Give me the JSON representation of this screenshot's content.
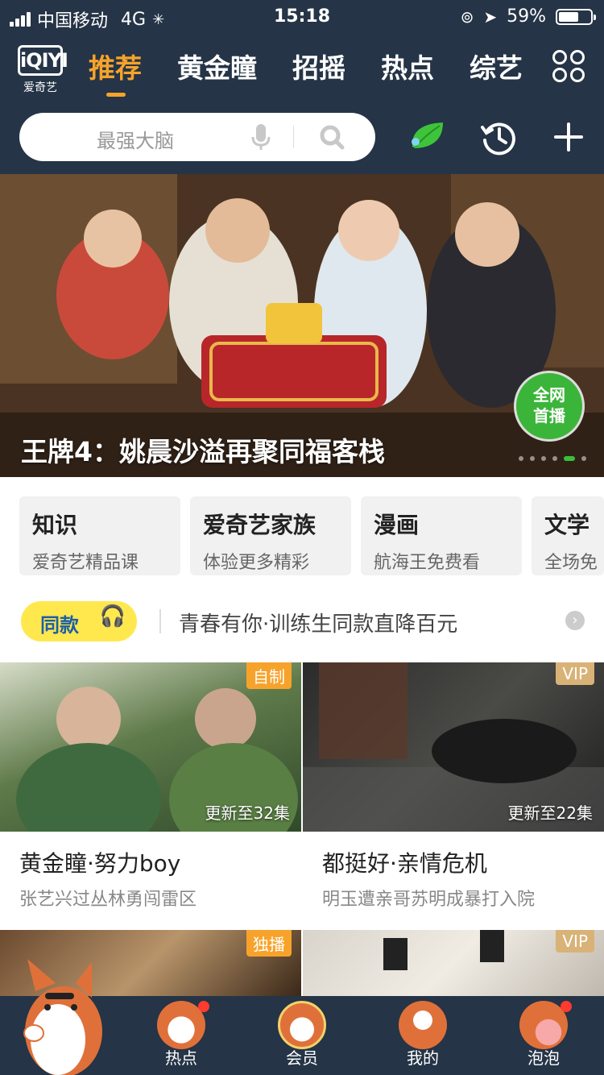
{
  "status_bar": {
    "carrier": "中国移动",
    "network": "4G",
    "time": "15:18",
    "battery": "59%",
    "battery_level": 0.59
  },
  "header": {
    "logo_mark": "iQIYI",
    "logo_cn": "爱奇艺",
    "tabs": [
      {
        "label": "推荐",
        "active": true
      },
      {
        "label": "黄金瞳",
        "active": false
      },
      {
        "label": "招摇",
        "active": false
      },
      {
        "label": "热点",
        "active": false
      },
      {
        "label": "综艺",
        "active": false
      }
    ],
    "icons": [
      "more-grid-icon",
      "leaf-icon",
      "history-clock-icon",
      "plus-icon"
    ],
    "search_placeholder": "最强大脑"
  },
  "banner": {
    "title": "王牌4：姚晨沙溢再聚同福客栈",
    "live_badge": [
      "全网",
      "首播"
    ],
    "slide_count": 6,
    "active_slide": 5
  },
  "categories": [
    {
      "title": "知识",
      "subtitle": "爱奇艺精品课"
    },
    {
      "title": "爱奇艺家族",
      "subtitle": "体验更多精彩"
    },
    {
      "title": "漫画",
      "subtitle": "航海王免费看"
    },
    {
      "title": "文学",
      "subtitle": "全场免"
    }
  ],
  "promo": {
    "pill_label": "同款",
    "text": "青春有你·训练生同款直降百元"
  },
  "cards": [
    {
      "tag": "自制",
      "episode": "更新至32集",
      "title": "黄金瞳·努力boy",
      "subtitle": "张艺兴过丛林勇闯雷区"
    },
    {
      "tag": "VIP",
      "episode": "更新至22集",
      "title": "都挺好·亲情危机",
      "subtitle": "明玉遭亲哥苏明成暴打入院"
    },
    {
      "tag": "独播",
      "episode": "",
      "title": "",
      "subtitle": ""
    },
    {
      "tag": "VIP",
      "episode": "",
      "title": "",
      "subtitle": ""
    }
  ],
  "tabbar": [
    {
      "label": "",
      "icon": "mascot-home-icon"
    },
    {
      "label": "热点",
      "icon": "dog-face-icon"
    },
    {
      "label": "会员",
      "icon": "dog-glasses-icon"
    },
    {
      "label": "我的",
      "icon": "dog-back-icon"
    },
    {
      "label": "泡泡",
      "icon": "dog-bubble-icon"
    }
  ],
  "colors": {
    "nav_bg": "#253446",
    "accent": "#f7a32b",
    "vip_gold": "#d9b277",
    "live_green": "#3bb43a"
  }
}
